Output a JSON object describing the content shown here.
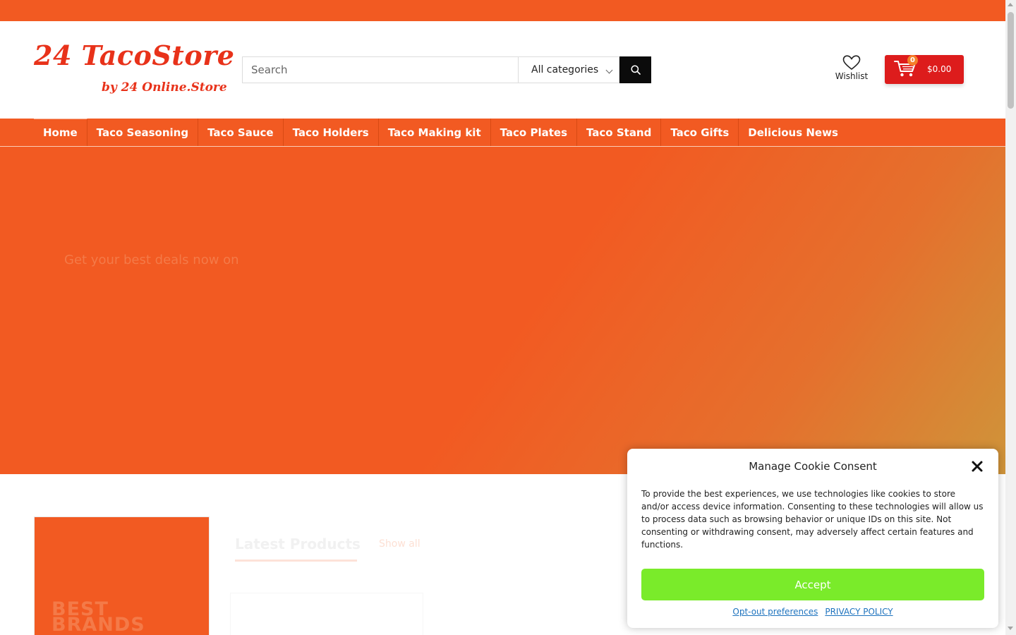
{
  "logo": {
    "main": "24 TacoStore",
    "sub": "by 24 Online.Store"
  },
  "search": {
    "placeholder": "Search",
    "category": "All categories"
  },
  "wishlist": {
    "label": "Wishlist"
  },
  "cart": {
    "count": "0",
    "total": "$0.00"
  },
  "nav": {
    "items": [
      {
        "label": "Home"
      },
      {
        "label": "Taco Seasoning"
      },
      {
        "label": "Taco Sauce"
      },
      {
        "label": "Taco Holders"
      },
      {
        "label": "Taco Making kit"
      },
      {
        "label": "Taco Plates"
      },
      {
        "label": "Taco Stand"
      },
      {
        "label": "Taco Gifts"
      },
      {
        "label": "Delicious News"
      }
    ]
  },
  "hero": {
    "text": "Get your best deals now on"
  },
  "brands": {
    "title": "BEST BRANDS"
  },
  "products": {
    "tab_label": "Latest Products",
    "show_all": "Show all"
  },
  "cookie": {
    "title": "Manage Cookie Consent",
    "body": "To provide the best experiences, we use technologies like cookies to store and/or access device information. Consenting to these technologies will allow us to process data such as browsing behavior or unique IDs on this site. Not consenting or withdrawing consent, may adversely affect certain features and functions.",
    "accept": "Accept",
    "opt_out": "Opt-out preferences",
    "privacy": "PRIVACY POLICY"
  },
  "colors": {
    "brand_orange": "#f25a22",
    "cart_red": "#dd1c1c",
    "accept_green": "#7aeb2a",
    "logo_red": "#e8321a"
  },
  "icons": {
    "search": "search-icon",
    "wishlist": "heart-icon",
    "cart": "cart-icon",
    "close": "close-icon",
    "dropdown": "chevron-down-icon"
  }
}
